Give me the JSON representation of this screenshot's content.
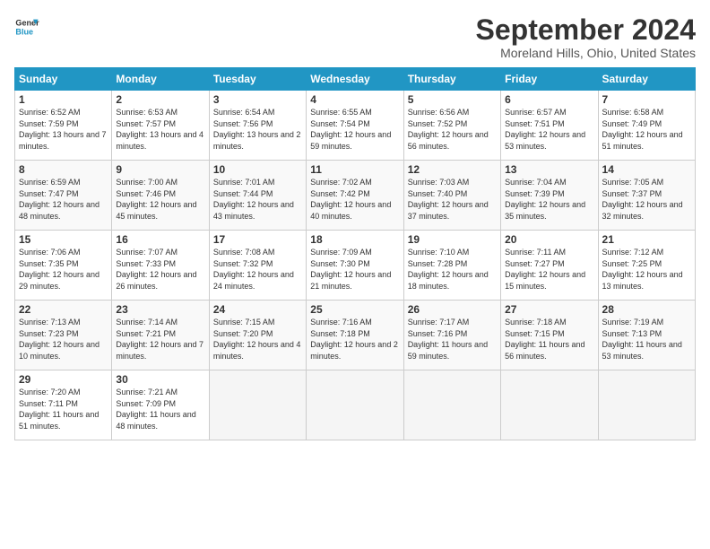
{
  "header": {
    "logo_line1": "General",
    "logo_line2": "Blue",
    "month": "September 2024",
    "location": "Moreland Hills, Ohio, United States"
  },
  "days_of_week": [
    "Sunday",
    "Monday",
    "Tuesday",
    "Wednesday",
    "Thursday",
    "Friday",
    "Saturday"
  ],
  "weeks": [
    [
      {
        "num": "1",
        "rise": "6:52 AM",
        "set": "7:59 PM",
        "daylight": "13 hours and 7 minutes."
      },
      {
        "num": "2",
        "rise": "6:53 AM",
        "set": "7:57 PM",
        "daylight": "13 hours and 4 minutes."
      },
      {
        "num": "3",
        "rise": "6:54 AM",
        "set": "7:56 PM",
        "daylight": "13 hours and 2 minutes."
      },
      {
        "num": "4",
        "rise": "6:55 AM",
        "set": "7:54 PM",
        "daylight": "12 hours and 59 minutes."
      },
      {
        "num": "5",
        "rise": "6:56 AM",
        "set": "7:52 PM",
        "daylight": "12 hours and 56 minutes."
      },
      {
        "num": "6",
        "rise": "6:57 AM",
        "set": "7:51 PM",
        "daylight": "12 hours and 53 minutes."
      },
      {
        "num": "7",
        "rise": "6:58 AM",
        "set": "7:49 PM",
        "daylight": "12 hours and 51 minutes."
      }
    ],
    [
      {
        "num": "8",
        "rise": "6:59 AM",
        "set": "7:47 PM",
        "daylight": "12 hours and 48 minutes."
      },
      {
        "num": "9",
        "rise": "7:00 AM",
        "set": "7:46 PM",
        "daylight": "12 hours and 45 minutes."
      },
      {
        "num": "10",
        "rise": "7:01 AM",
        "set": "7:44 PM",
        "daylight": "12 hours and 43 minutes."
      },
      {
        "num": "11",
        "rise": "7:02 AM",
        "set": "7:42 PM",
        "daylight": "12 hours and 40 minutes."
      },
      {
        "num": "12",
        "rise": "7:03 AM",
        "set": "7:40 PM",
        "daylight": "12 hours and 37 minutes."
      },
      {
        "num": "13",
        "rise": "7:04 AM",
        "set": "7:39 PM",
        "daylight": "12 hours and 35 minutes."
      },
      {
        "num": "14",
        "rise": "7:05 AM",
        "set": "7:37 PM",
        "daylight": "12 hours and 32 minutes."
      }
    ],
    [
      {
        "num": "15",
        "rise": "7:06 AM",
        "set": "7:35 PM",
        "daylight": "12 hours and 29 minutes."
      },
      {
        "num": "16",
        "rise": "7:07 AM",
        "set": "7:33 PM",
        "daylight": "12 hours and 26 minutes."
      },
      {
        "num": "17",
        "rise": "7:08 AM",
        "set": "7:32 PM",
        "daylight": "12 hours and 24 minutes."
      },
      {
        "num": "18",
        "rise": "7:09 AM",
        "set": "7:30 PM",
        "daylight": "12 hours and 21 minutes."
      },
      {
        "num": "19",
        "rise": "7:10 AM",
        "set": "7:28 PM",
        "daylight": "12 hours and 18 minutes."
      },
      {
        "num": "20",
        "rise": "7:11 AM",
        "set": "7:27 PM",
        "daylight": "12 hours and 15 minutes."
      },
      {
        "num": "21",
        "rise": "7:12 AM",
        "set": "7:25 PM",
        "daylight": "12 hours and 13 minutes."
      }
    ],
    [
      {
        "num": "22",
        "rise": "7:13 AM",
        "set": "7:23 PM",
        "daylight": "12 hours and 10 minutes."
      },
      {
        "num": "23",
        "rise": "7:14 AM",
        "set": "7:21 PM",
        "daylight": "12 hours and 7 minutes."
      },
      {
        "num": "24",
        "rise": "7:15 AM",
        "set": "7:20 PM",
        "daylight": "12 hours and 4 minutes."
      },
      {
        "num": "25",
        "rise": "7:16 AM",
        "set": "7:18 PM",
        "daylight": "12 hours and 2 minutes."
      },
      {
        "num": "26",
        "rise": "7:17 AM",
        "set": "7:16 PM",
        "daylight": "11 hours and 59 minutes."
      },
      {
        "num": "27",
        "rise": "7:18 AM",
        "set": "7:15 PM",
        "daylight": "11 hours and 56 minutes."
      },
      {
        "num": "28",
        "rise": "7:19 AM",
        "set": "7:13 PM",
        "daylight": "11 hours and 53 minutes."
      }
    ],
    [
      {
        "num": "29",
        "rise": "7:20 AM",
        "set": "7:11 PM",
        "daylight": "11 hours and 51 minutes."
      },
      {
        "num": "30",
        "rise": "7:21 AM",
        "set": "7:09 PM",
        "daylight": "11 hours and 48 minutes."
      },
      null,
      null,
      null,
      null,
      null
    ]
  ]
}
